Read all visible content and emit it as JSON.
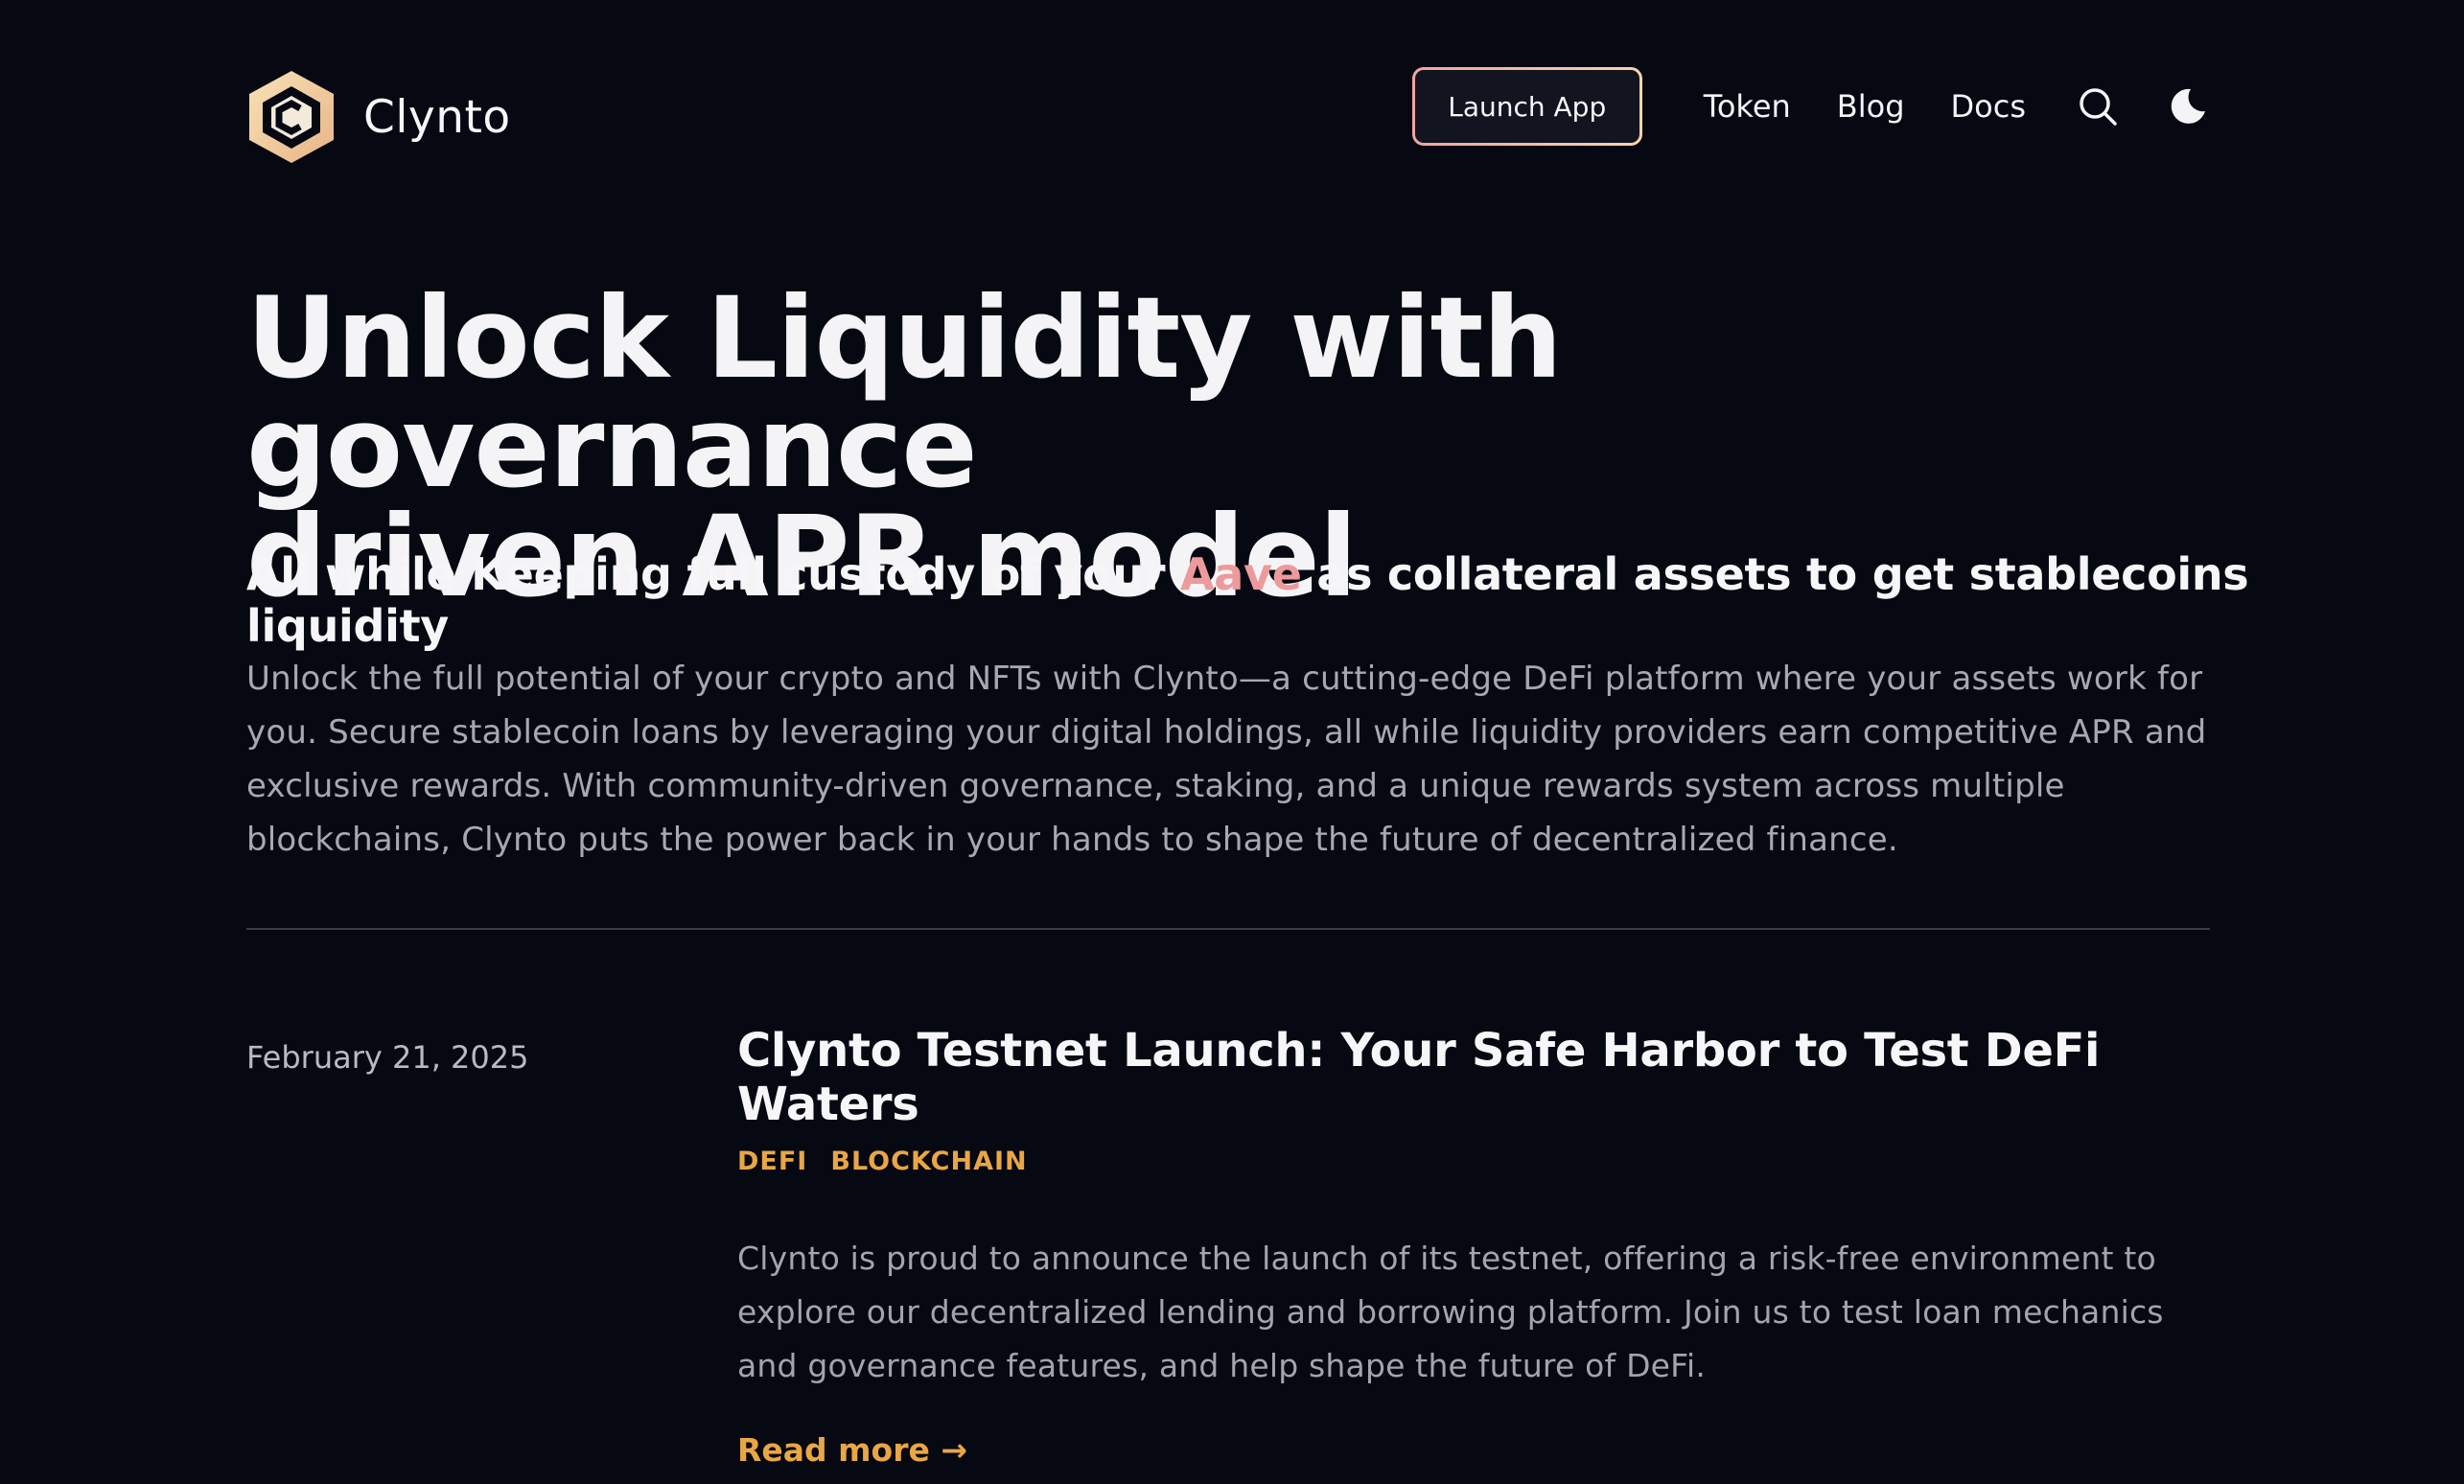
{
  "brand": {
    "name": "Clynto",
    "logo_icon": "clynto-hexagon-logo-icon"
  },
  "nav": {
    "launch_label": "Launch App",
    "links": [
      "Token",
      "Blog",
      "Docs"
    ],
    "search_icon": "search-icon",
    "theme_icon": "moon-icon"
  },
  "hero": {
    "title_line1": "Unlock Liquidity with governance",
    "title_line2": "driven APR model",
    "subtitle_before": "All while Keeping full custody of your ",
    "subtitle_accent": "Aave",
    "subtitle_after": " as collateral assets to get stablecoins liquidity",
    "description": "Unlock the full potential of your crypto and NFTs with Clynto—a cutting-edge DeFi platform where your assets work for you. Secure stablecoin loans by leveraging your digital holdings, all while liquidity providers earn competitive APR and exclusive rewards. With community-driven governance, staking, and a unique rewards system across multiple blockchains, Clynto puts the power back in your hands to shape the future of decentralized finance."
  },
  "posts": [
    {
      "date": "February 21, 2025",
      "title": "Clynto Testnet Launch: Your Safe Harbor to Test DeFi Waters",
      "tags": [
        "DEFI",
        "BLOCKCHAIN"
      ],
      "body": "Clynto is proud to announce the launch of its testnet, offering a risk-free environment to explore our decentralized lending and borrowing platform. Join us to test loan mechanics and governance features, and help shape the future of DeFi.",
      "read_more": "Read more →"
    }
  ],
  "colors": {
    "background": "#060812",
    "accent_pink": "#ec9a9c",
    "accent_orange": "#e9a646",
    "muted_text": "#a7a8b0"
  }
}
